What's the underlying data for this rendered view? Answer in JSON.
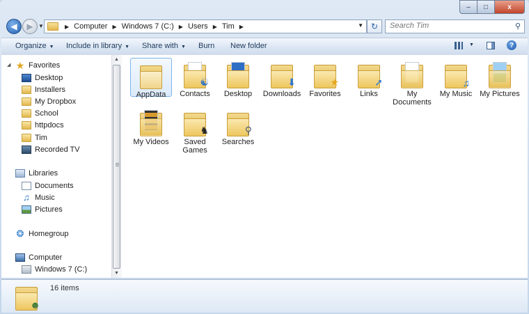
{
  "window": {
    "caption": {
      "minimize": "–",
      "maximize": "□",
      "close": "x"
    }
  },
  "address": {
    "crumbs": [
      "Computer",
      "Windows 7 (C:)",
      "Users",
      "Tim"
    ]
  },
  "search": {
    "placeholder": "Search Tim"
  },
  "toolbar": {
    "organize": "Organize",
    "include": "Include in library",
    "share": "Share with",
    "burn": "Burn",
    "new_folder": "New folder"
  },
  "nav": {
    "favorites": {
      "label": "Favorites",
      "items": [
        "Desktop",
        "Installers",
        "My Dropbox",
        "School",
        "httpdocs",
        "Tim",
        "Recorded TV"
      ]
    },
    "libraries": {
      "label": "Libraries",
      "items": [
        "Documents",
        "Music",
        "Pictures"
      ]
    },
    "homegroup": {
      "label": "Homegroup"
    },
    "computer": {
      "label": "Computer",
      "items": [
        "Windows 7 (C:)"
      ]
    }
  },
  "files": [
    {
      "label": "AppData",
      "icon": "plain-folder-icon",
      "selected": true
    },
    {
      "label": "Contacts",
      "icon": "contacts-folder-icon"
    },
    {
      "label": "Desktop",
      "icon": "desktop-folder-icon"
    },
    {
      "label": "Downloads",
      "icon": "downloads-folder-icon"
    },
    {
      "label": "Favorites",
      "icon": "favorites-folder-icon"
    },
    {
      "label": "Links",
      "icon": "links-folder-icon"
    },
    {
      "label": "My Documents",
      "icon": "documents-folder-icon"
    },
    {
      "label": "My Music",
      "icon": "music-folder-icon"
    },
    {
      "label": "My Pictures",
      "icon": "pictures-folder-icon"
    },
    {
      "label": "My Videos",
      "icon": "videos-folder-icon"
    },
    {
      "label": "Saved Games",
      "icon": "games-folder-icon"
    },
    {
      "label": "Searches",
      "icon": "searches-folder-icon"
    }
  ],
  "details": {
    "count": "16 items"
  },
  "colors": {
    "accent": "#1e395b",
    "selection": "#dcebfc"
  }
}
